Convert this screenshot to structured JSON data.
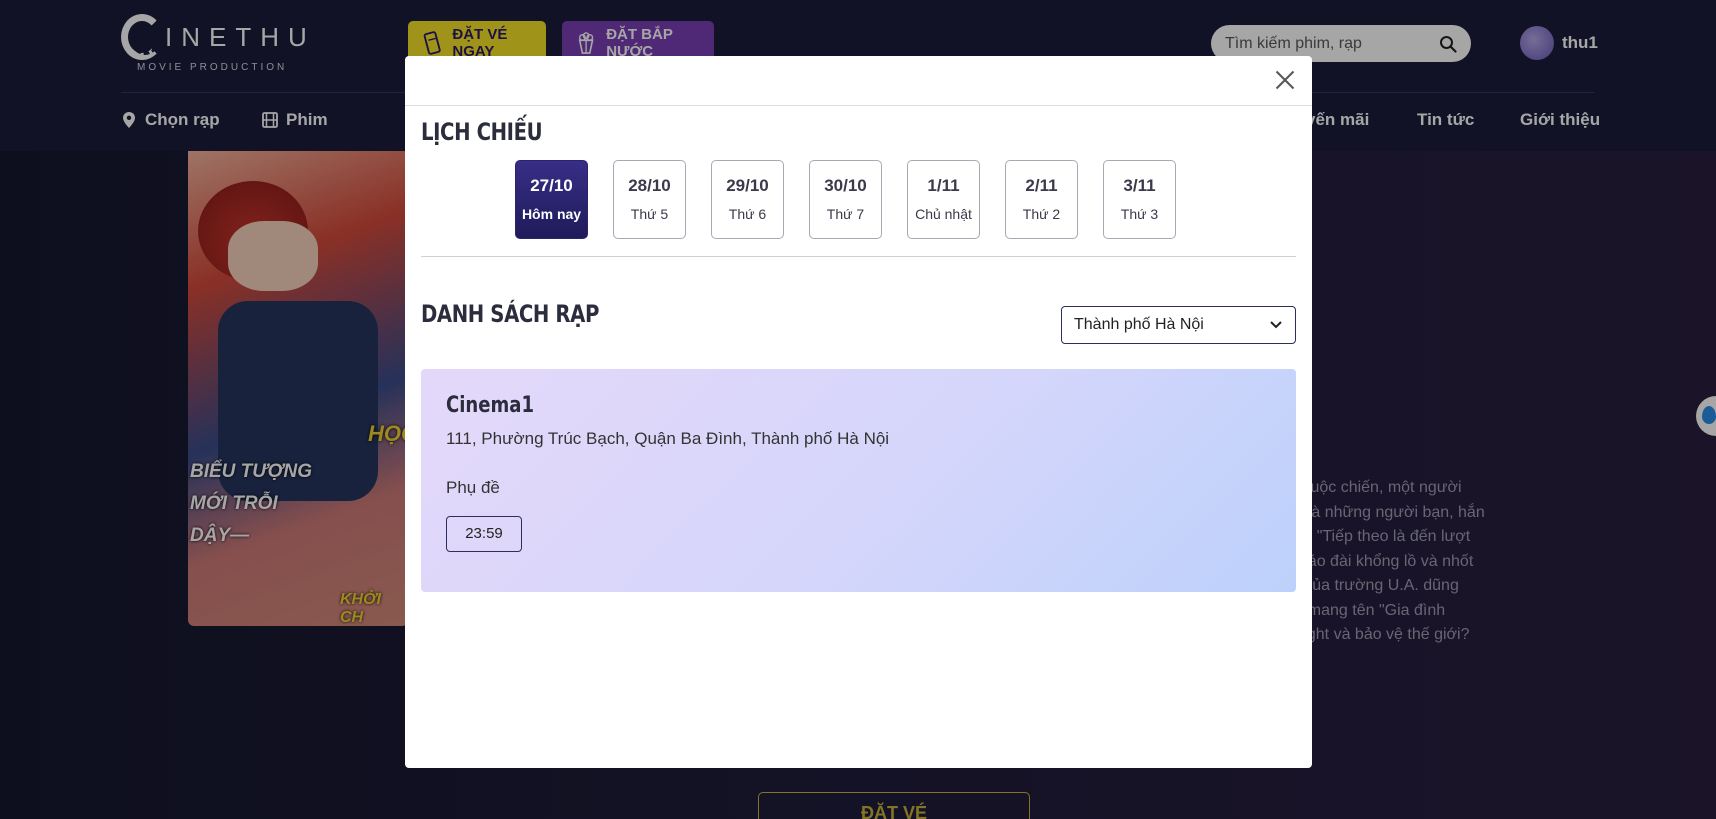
{
  "header": {
    "logo_word": "INETHU",
    "logo_sub": "MOVIE PRODUCTION",
    "btn_ticket": "ĐẶT VÉ NGAY",
    "btn_snack": "ĐẶT BẮP NƯỚC",
    "search_placeholder": "Tìm kiếm phim, rạp",
    "username": "thu1",
    "nav": {
      "theater": "Chọn rạp",
      "movies": "Phim",
      "promo": "yến mãi",
      "news": "Tin tức",
      "about": "Giới thiệu"
    }
  },
  "background": {
    "poster_line1": "BIỂU TƯỢNG",
    "poster_line2": "MỚI TRỖI",
    "poster_line3": "DẬY—",
    "poster_bottom": "KHỞI CH",
    "poster_title_fragment": "HỌC",
    "description_lines": [
      "c cuộc chiến, một người",
      "u và những người bạn, hắn",
      "ồn: \"Tiếp theo là đến lượt",
      "pháo đài khổng lồ và nhốt",
      "A của trường U.A. dũng",
      "u, mang tên \"Gia đình",
      "Might và bảo vệ thế giới?"
    ],
    "book_button": "ĐẶT VÉ"
  },
  "modal": {
    "schedule_title": "LỊCH CHIẾU",
    "dates": [
      {
        "date": "27/10",
        "weekday": "Hôm nay",
        "active": true
      },
      {
        "date": "28/10",
        "weekday": "Thứ 5",
        "active": false
      },
      {
        "date": "29/10",
        "weekday": "Thứ 6",
        "active": false
      },
      {
        "date": "30/10",
        "weekday": "Thứ 7",
        "active": false
      },
      {
        "date": "1/11",
        "weekday": "Chủ nhật",
        "active": false
      },
      {
        "date": "2/11",
        "weekday": "Thứ 2",
        "active": false
      },
      {
        "date": "3/11",
        "weekday": "Thứ 3",
        "active": false
      }
    ],
    "cinema_list_title": "DANH SÁCH RẠP",
    "city_select": "Thành phố Hà Nội",
    "cinema": {
      "name": "Cinema1",
      "address": "111, Phường Trúc Bạch, Quận Ba Đình, Thành phố Hà Nội",
      "format": "Phụ đề",
      "showtime": "23:59"
    }
  },
  "colors": {
    "header_bg": "#1c1d3d",
    "ticket_yellow": "#f6e227",
    "snack_purple": "#7c3fb6",
    "active_date": "#2a2470"
  }
}
